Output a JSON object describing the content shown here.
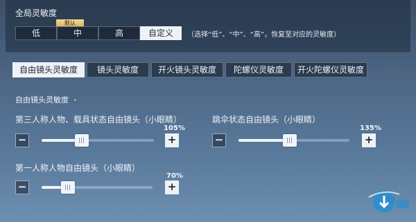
{
  "global": {
    "title": "全局灵敏度",
    "presets": [
      "低",
      "中",
      "高",
      "自定义"
    ],
    "active_preset": "自定义",
    "default_badge": "默认",
    "hint": "（选择“低”、“中”、“高”，恢复至对应的灵敏度）"
  },
  "tabs": [
    "自由镜头灵敏度",
    "镜头灵敏度",
    "开火镜头灵敏度",
    "陀螺仪灵敏度",
    "开火陀螺仪灵敏度"
  ],
  "active_tab": "自由镜头灵敏度",
  "section": {
    "title": "自由镜头灵敏度",
    "sliders": [
      {
        "label": "第三人称人物、载具状态自由镜头（小眼睛）",
        "value": "105%",
        "level": 0.36
      },
      {
        "label": "跳伞状态自由镜头（小眼睛）",
        "value": "135%",
        "level": 0.46
      },
      {
        "label": "第一人称人物自由镜头（小眼睛）",
        "value": "70%",
        "level": 0.24
      }
    ],
    "minus_symbol": "−",
    "plus_symbol": "+"
  },
  "colors": {
    "active_bg": "#eef2f7",
    "badge": "#d9b35c",
    "logo_accent": "#1e8fd8"
  }
}
